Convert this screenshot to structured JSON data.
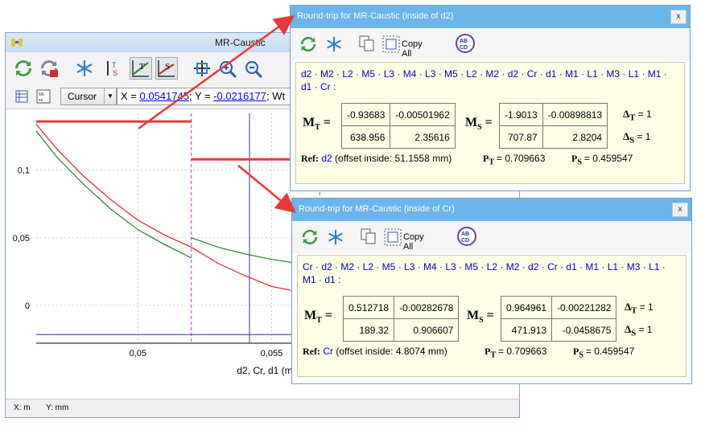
{
  "main_window": {
    "title": "MR-Caustic",
    "cursor_mode": "Cursor",
    "coord": {
      "x_prefix": "X = ",
      "x_value": "0.0541745",
      "y_prefix": "; Y = ",
      "y_value": "-0.0216177",
      "tail": "; Wt"
    },
    "status": {
      "x_unit": "X: m",
      "y_unit": "Y: mm"
    }
  },
  "chart_data": {
    "type": "line",
    "xlabel": "d2, Cr, d1 (m)",
    "xlim": [
      0.0462,
      0.0592
    ],
    "ylim": [
      -0.028,
      0.142
    ],
    "x_ticks": [
      0.05,
      0.055
    ],
    "x_tick_labels": [
      "0,05",
      "0,055"
    ],
    "y_ticks": [
      0,
      0.05,
      0.1
    ],
    "y_tick_labels": [
      "0",
      "0,05",
      "0,1"
    ],
    "series": [
      {
        "color": "#e02020",
        "x": [
          0.0462,
          0.047,
          0.048,
          0.049,
          0.05,
          0.051,
          0.052
        ],
        "y": [
          0.134,
          0.115,
          0.095,
          0.078,
          0.063,
          0.052,
          0.043
        ]
      },
      {
        "color": "#208020",
        "x": [
          0.0462,
          0.047,
          0.048,
          0.049,
          0.05,
          0.051,
          0.052
        ],
        "y": [
          0.129,
          0.109,
          0.089,
          0.071,
          0.056,
          0.045,
          0.035
        ]
      },
      {
        "color": "#e02020",
        "x": [
          0.052,
          0.053,
          0.054,
          0.055,
          0.056,
          0.057,
          0.0575,
          0.0585
        ],
        "y": [
          0.043,
          0.031,
          0.022,
          0.014,
          0.01,
          0.011,
          0.016,
          0.025
        ]
      },
      {
        "color": "#208020",
        "x": [
          0.052,
          0.053,
          0.054,
          0.055,
          0.056,
          0.057,
          0.0575,
          0.0585
        ],
        "y": [
          0.05,
          0.043,
          0.038,
          0.034,
          0.031,
          0.028,
          0.01,
          0.012
        ]
      }
    ],
    "ref_segments": [
      {
        "x0": 0.0462,
        "x1": 0.052,
        "y": 0.136
      },
      {
        "x0": 0.052,
        "x1": 0.0573,
        "y": 0.108
      }
    ],
    "boundaries_magenta": [
      0.052,
      0.0568
    ],
    "cursor_x": 0.0541745,
    "cursor_y": -0.0216177,
    "grid": true
  },
  "popup1": {
    "title": "Round-trip for MR-Caustic (inside of d2)",
    "copy_all": "Copy All",
    "path": "d2 · M2 · L2 · M5 · L3 · M4 · L3 · M5 · L2 · M2 · d2 · Cr · d1 · M1 · L1 · M3 · L1 · M1 · d1 · Cr :",
    "mt": [
      [
        "-0.93683",
        "-0.00501962"
      ],
      [
        "638.956",
        "2.35616"
      ]
    ],
    "ms": [
      [
        "-1.9013",
        "-0.00898813"
      ],
      [
        "707.87",
        "2.8204"
      ]
    ],
    "delta_t": "= 1",
    "delta_s": "= 1",
    "ref_label": "Ref:",
    "ref_link": "d2",
    "ref_offset": "(offset inside: 51.1558 mm)",
    "pt": "= 0.709663",
    "ps": "= 0.459547"
  },
  "popup2": {
    "title": "Round-trip for MR-Caustic (inside of Cr)",
    "copy_all": "Copy All",
    "path": "Cr · d2 · M2 · L2 · M5 · L3 · M4 · L3 · M5 · L2 · M2 · d2 · Cr · d1 · M1 · L1 · M3 · L1 · M1 · d1 :",
    "mt": [
      [
        "0.512718",
        "-0.00282678"
      ],
      [
        "189.32",
        "0.906607"
      ]
    ],
    "ms": [
      [
        "0.964961",
        "-0.00221282"
      ],
      [
        "471.913",
        "-0.0458675"
      ]
    ],
    "delta_t": "= 1",
    "delta_s": "= 1",
    "ref_label": "Ref:",
    "ref_link": "Cr",
    "ref_offset": "(offset inside: 4.8074 mm)",
    "pt": "= 0.709663",
    "ps": "= 0.459547"
  },
  "colors": {
    "accent": "#6bb5ea",
    "panel_bg": "#ffffe6",
    "link": "#0000c8",
    "arrow": "#e8393a"
  }
}
